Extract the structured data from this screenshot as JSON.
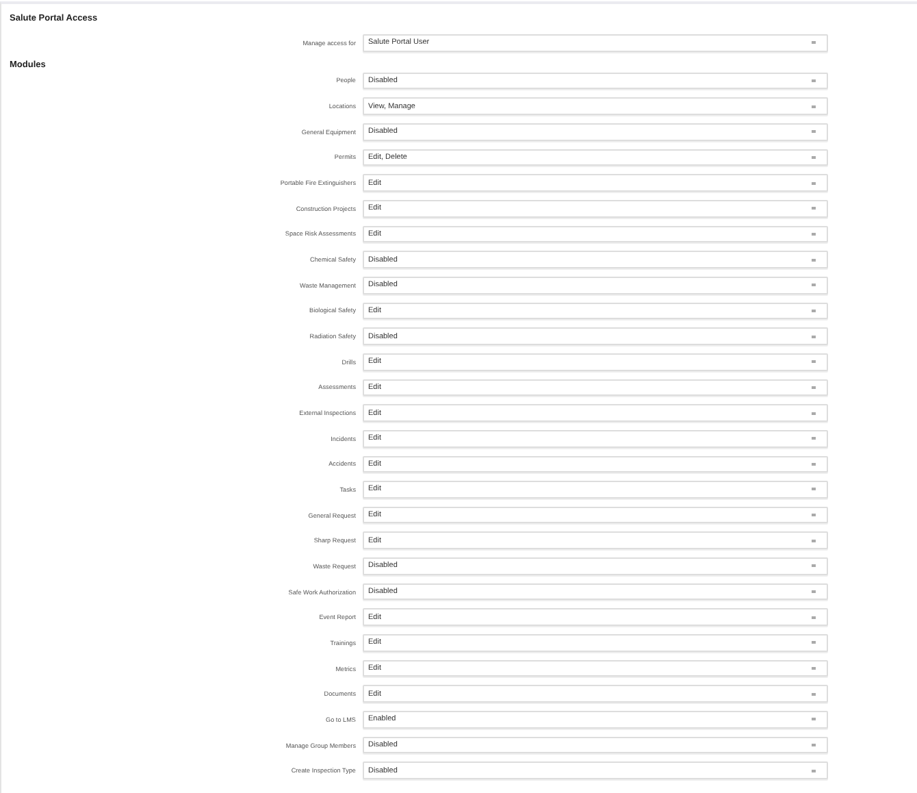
{
  "access_section": {
    "title": "Salute Portal Access",
    "field": {
      "label": "Manage access for",
      "value": "Salute Portal User"
    }
  },
  "modules_section": {
    "title": "Modules",
    "rows": [
      {
        "label": "People",
        "value": "Disabled"
      },
      {
        "label": "Locations",
        "value": "View, Manage"
      },
      {
        "label": "General Equipment",
        "value": "Disabled"
      },
      {
        "label": "Permits",
        "value": "Edit, Delete"
      },
      {
        "label": "Portable Fire Extinguishers",
        "value": "Edit"
      },
      {
        "label": "Construction Projects",
        "value": "Edit"
      },
      {
        "label": "Space Risk Assessments",
        "value": "Edit"
      },
      {
        "label": "Chemical Safety",
        "value": "Disabled"
      },
      {
        "label": "Waste Management",
        "value": "Disabled"
      },
      {
        "label": "Biological Safety",
        "value": "Edit"
      },
      {
        "label": "Radiation Safety",
        "value": "Disabled"
      },
      {
        "label": "Drills",
        "value": "Edit"
      },
      {
        "label": "Assessments",
        "value": "Edit"
      },
      {
        "label": "External Inspections",
        "value": "Edit"
      },
      {
        "label": "Incidents",
        "value": "Edit"
      },
      {
        "label": "Accidents",
        "value": "Edit"
      },
      {
        "label": "Tasks",
        "value": "Edit"
      },
      {
        "label": "General Request",
        "value": "Edit"
      },
      {
        "label": "Sharp Request",
        "value": "Edit"
      },
      {
        "label": "Waste Request",
        "value": "Disabled"
      },
      {
        "label": "Safe Work Authorization",
        "value": "Disabled"
      },
      {
        "label": "Event Report",
        "value": "Edit"
      },
      {
        "label": "Trainings",
        "value": "Edit"
      },
      {
        "label": "Metrics",
        "value": "Edit"
      },
      {
        "label": "Documents",
        "value": "Edit"
      },
      {
        "label": "Go to LMS",
        "value": "Enabled"
      },
      {
        "label": "Manage Group Members",
        "value": "Disabled"
      },
      {
        "label": "Create Inspection Type",
        "value": "Disabled"
      }
    ]
  }
}
